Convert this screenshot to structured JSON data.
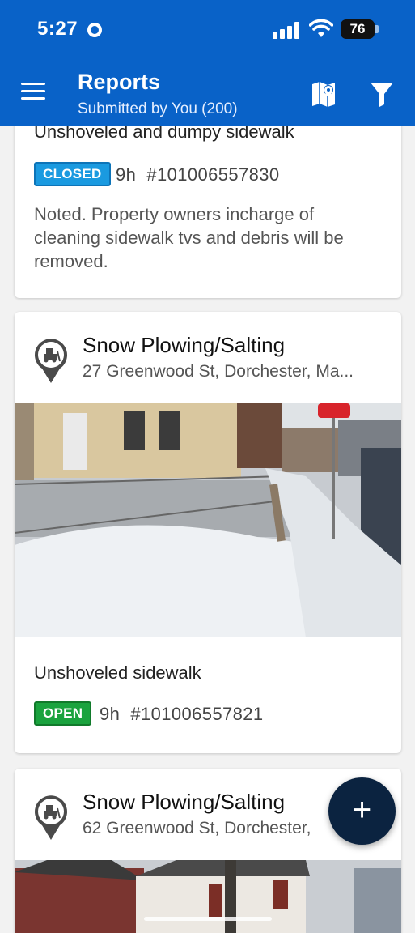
{
  "status_bar": {
    "time": "5:27",
    "battery": "76"
  },
  "header": {
    "title": "Reports",
    "subtitle": "Submitted by You (200)",
    "color": "#0962c8"
  },
  "reports": [
    {
      "description": "Unshoveled and dumpy sidewalk",
      "status": "CLOSED",
      "age": "9h",
      "id": "#101006557830",
      "note": "Noted. Property owners incharge of cleaning sidewalk tvs and debris will be removed.",
      "status_color": "#1a9ae0"
    },
    {
      "category": "Snow Plowing/Salting",
      "address": "27 Greenwood St, Dorchester, Ma...",
      "description": "Unshoveled sidewalk",
      "status": "OPEN",
      "age": "9h",
      "id": "#101006557821",
      "status_color": "#1aa33e"
    },
    {
      "category": "Snow Plowing/Salting",
      "address": "62 Greenwood St, Dorchester,"
    }
  ],
  "fab": {
    "label": "+"
  },
  "icons": [
    "menu-icon",
    "map-icon",
    "filter-icon",
    "snow-plow-pin-icon",
    "add-icon"
  ]
}
